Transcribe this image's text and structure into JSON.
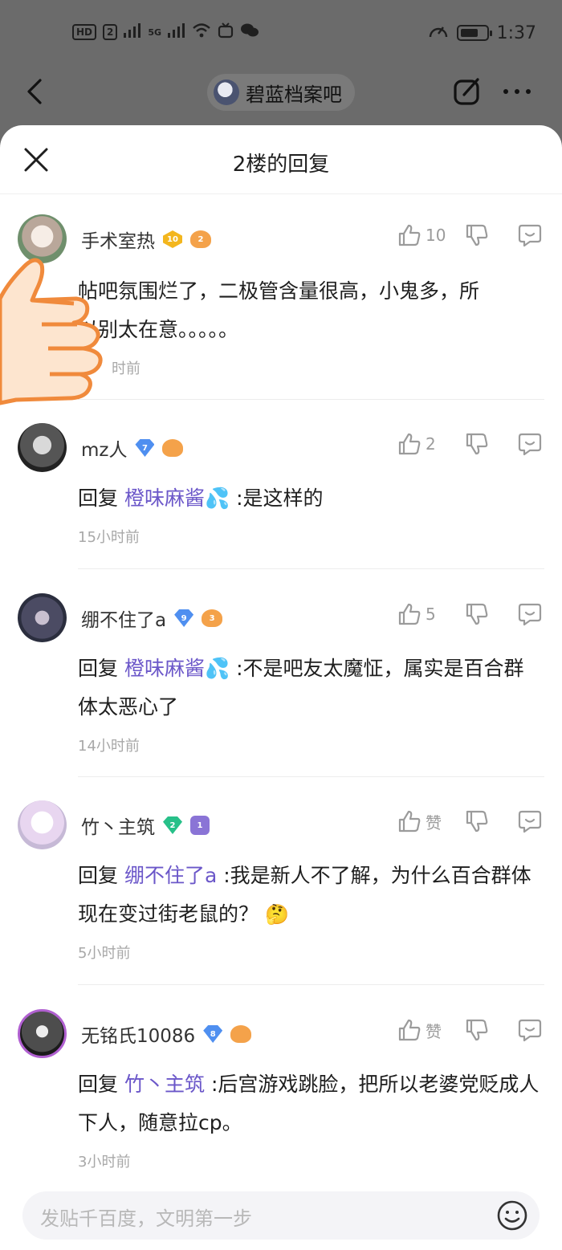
{
  "status_bar": {
    "left_chips": [
      "HD",
      "2"
    ],
    "network": "5G",
    "time": "1:37"
  },
  "top_nav": {
    "forum_name": "碧蓝档案吧"
  },
  "sheet": {
    "title": "2楼的回复"
  },
  "comments": [
    {
      "username": "手术室热",
      "level": "10",
      "fan_level": "2",
      "likes": "10",
      "text_lines": [
        "帖吧氛围烂了，二极管含量很高，小鬼多，所",
        "以别太在意。。。。。"
      ],
      "time": "时前"
    },
    {
      "username": "mz人",
      "level": "7",
      "fan_level": "",
      "likes": "2",
      "reply_kw": "回复",
      "reply_to": "橙味麻酱💦",
      "text": ":是这样的",
      "time": "15小时前"
    },
    {
      "username": "绷不住了a",
      "level": "9",
      "fan_level": "3",
      "likes": "5",
      "reply_kw": "回复",
      "reply_to": "橙味麻酱💦",
      "text": ":不是吧友太魔怔，属实是百合群体太恶心了",
      "time": "14小时前"
    },
    {
      "username": "竹丶主筑",
      "level": "2",
      "fan_level": "1",
      "likes": "赞",
      "reply_kw": "回复",
      "reply_to": "绷不住了a",
      "text": ":我是新人不了解，为什么百合群体现在变过街老鼠的？",
      "emoji": "🤔",
      "time": "5小时前"
    },
    {
      "username": "无铭氏10086",
      "level": "8",
      "fan_level": "",
      "likes": "赞",
      "reply_kw": "回复",
      "reply_to": "竹丶主筑",
      "text": ":后宫游戏跳脸，把所以老婆党贬成人下人，随意拉cp。",
      "time": "3小时前"
    }
  ],
  "input": {
    "placeholder": "发贴千百度，文明第一步"
  },
  "icons": {
    "back": "chevron-left-icon",
    "edit": "edit-icon",
    "more": "more-icon",
    "close": "close-icon",
    "like": "thumb-up-icon",
    "dislike": "thumb-down-icon",
    "reply": "comment-icon",
    "emoji": "emoji-icon"
  }
}
